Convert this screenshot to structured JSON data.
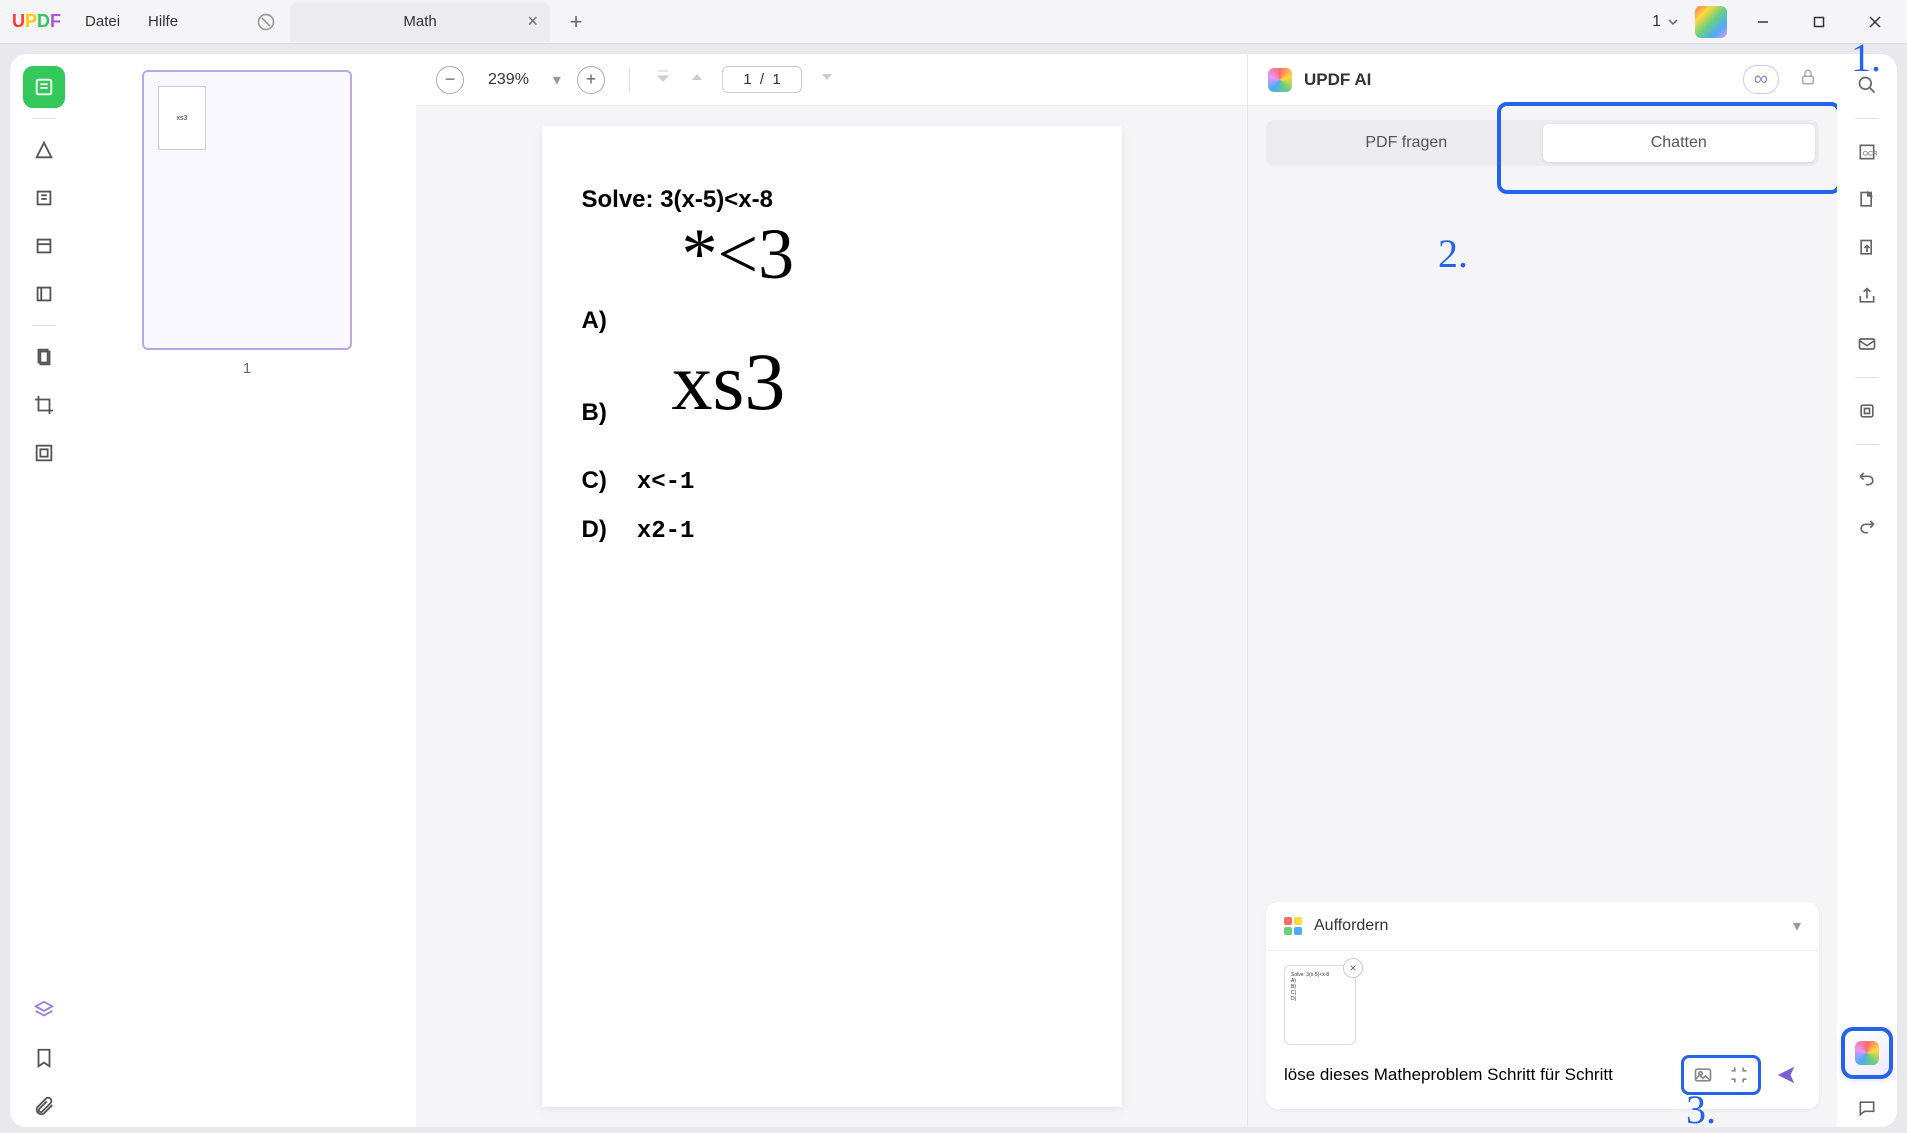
{
  "app": {
    "logo_text": "UPDF",
    "menu": {
      "file": "Datei",
      "help": "Hilfe"
    }
  },
  "tab": {
    "title": "Math"
  },
  "window": {
    "doc_count": "1"
  },
  "zoom": {
    "level": "239%"
  },
  "page_nav": {
    "current_total": "1  /  1"
  },
  "thumbnail": {
    "page_number": "1",
    "mini_text": "xs3"
  },
  "pdf": {
    "question": "Solve: 3(x-5)<x-8",
    "big1": "*<3",
    "optA_label": "A)",
    "big2": "xs3",
    "optB_label": "B)",
    "optC_label": "C)",
    "optC_val": "x<-1",
    "optD_label": "D)",
    "optD_val": "x2-1"
  },
  "ai": {
    "title": "UPDF AI",
    "tab_pdf": "PDF fragen",
    "tab_chat": "Chatten",
    "prompt_label": "Auffordern",
    "message": "löse dieses Matheproblem Schritt für Schritt",
    "attachment_preview": "Solve: 3(x-5)<x-8\nA)\nB)\nC)\nD)"
  },
  "annotations": {
    "n1": "1.",
    "n2": "2.",
    "n3": "3."
  }
}
